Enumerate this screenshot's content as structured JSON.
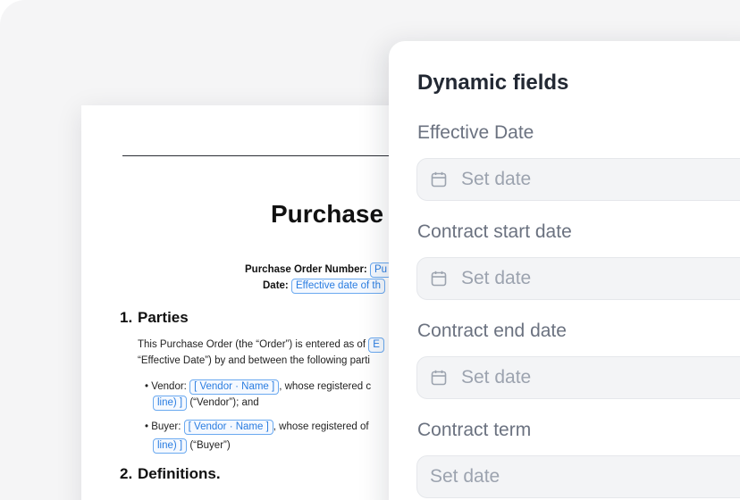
{
  "document": {
    "title": "Purchase",
    "order_number_label": "Purchase Order Number:",
    "order_number_chip": "Pu",
    "date_label": "Date:",
    "date_chip": "Effective date of th",
    "sections": [
      {
        "number": "1.",
        "title": "Parties"
      },
      {
        "number": "2.",
        "title": "Definitions."
      }
    ],
    "parties_text_1": "This Purchase Order (the “Order”) is entered as of",
    "parties_chip_1": "E",
    "parties_text_2": "“Effective Date”) by and between the following parti",
    "vendor_label": "• Vendor:",
    "vendor_chip": "[ Vendor · Name ]",
    "vendor_text": ", whose registered c",
    "vendor_line_chip": "line) ]",
    "vendor_suffix": "(“Vendor”); and",
    "buyer_label": "• Buyer:",
    "buyer_chip": "[ Vendor · Name ]",
    "buyer_text": ", whose registered of",
    "buyer_line_chip": "line) ]",
    "buyer_suffix": "(“Buyer”)"
  },
  "panel": {
    "title": "Dynamic fields",
    "fields": [
      {
        "label": "Effective Date",
        "placeholder": "Set date",
        "icon": "calendar-icon"
      },
      {
        "label": "Contract start date",
        "placeholder": "Set date",
        "icon": "calendar-icon"
      },
      {
        "label": "Contract end date",
        "placeholder": "Set date",
        "icon": "calendar-icon"
      },
      {
        "label": "Contract term",
        "placeholder": "Set date"
      }
    ]
  },
  "colors": {
    "chip_border": "#6aa9f0",
    "chip_text": "#2a7de1",
    "input_bg": "#f3f4f6",
    "label_gray": "#6b7280"
  }
}
